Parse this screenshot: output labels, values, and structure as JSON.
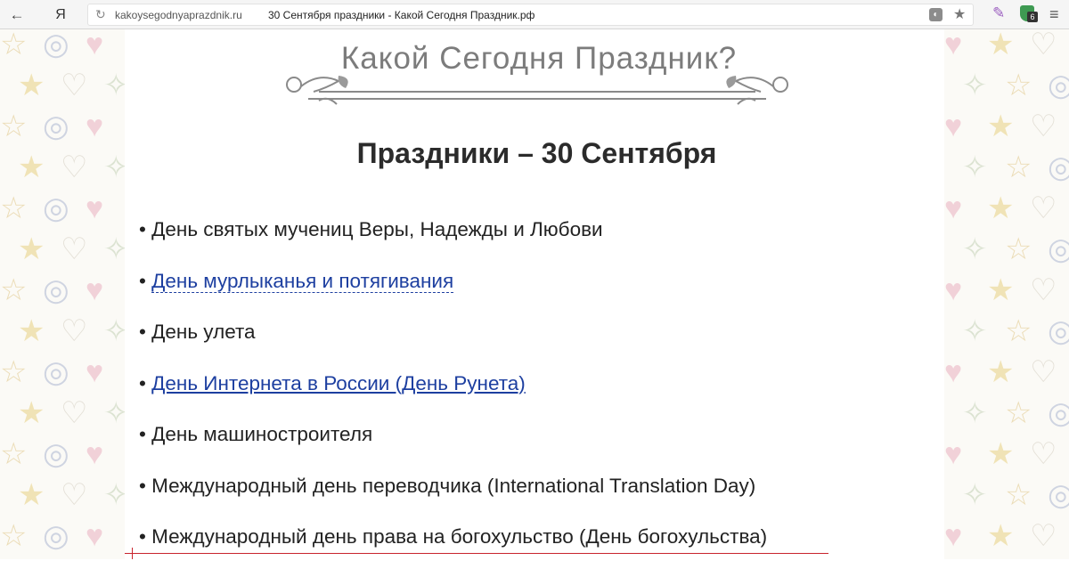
{
  "browser": {
    "back_icon": "←",
    "yandex_label": "Я",
    "reload_icon": "↻",
    "address_domain": "kakoysegodnyaprazdnik.ru",
    "address_title": "30 Сентября праздники - Какой Сегодня Праздник.рф",
    "star_icon": "★",
    "pen_icon": "✎",
    "extension_badge": "6",
    "menu_icon": "≡",
    "colors": {
      "toolbar": "#f5f5f5",
      "shield": "#3e9a52"
    }
  },
  "site": {
    "logo_text": "Какой Сегодня Праздник?"
  },
  "page": {
    "title": "Праздники – 30 Сентября",
    "bullet": "•",
    "items": [
      {
        "text": "День святых мучениц Веры, Надежды и Любови",
        "is_link": false
      },
      {
        "text": "День мурлыканья и потягивания",
        "is_link": true
      },
      {
        "text": "День улета",
        "is_link": false
      },
      {
        "text": "День Интернета в России (День Рунета)",
        "is_link": true
      },
      {
        "text": "День машиностроителя",
        "is_link": false
      },
      {
        "text": "Международный день переводчика (International Translation Day)",
        "is_link": false
      },
      {
        "text": "Международный день права на богохульство (День богохульства)",
        "is_link": false
      }
    ],
    "link_color": "#1d3fa0"
  },
  "decorations": {
    "side_icons": [
      "☆",
      "◎",
      "♥",
      "★",
      "♡",
      "✧"
    ]
  }
}
